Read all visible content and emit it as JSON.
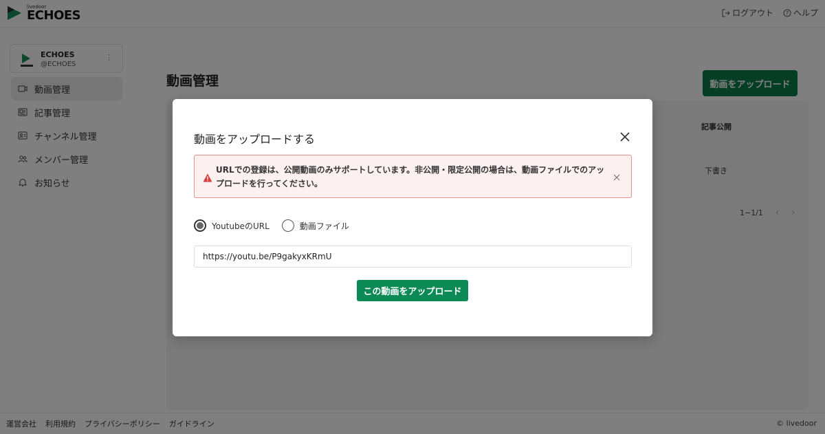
{
  "header": {
    "logo_small": "livedoor",
    "logo_big": "ECHOES",
    "logout_label": "ログアウト",
    "help_label": "ヘルプ"
  },
  "sidebar": {
    "channel": {
      "name": "ECHOES",
      "handle": "@ECHOES",
      "more_icon": "⋮"
    },
    "items": [
      {
        "label": "動画管理",
        "icon": "video-icon",
        "active": true
      },
      {
        "label": "記事管理",
        "icon": "article-icon",
        "active": false
      },
      {
        "label": "チャンネル管理",
        "icon": "channel-icon",
        "active": false
      },
      {
        "label": "メンバー管理",
        "icon": "members-icon",
        "active": false
      },
      {
        "label": "お知らせ",
        "icon": "bell-icon",
        "active": false
      }
    ]
  },
  "main": {
    "title": "動画管理",
    "upload_button": "動画をアップロード",
    "column_header": "記事公開",
    "draft_cell": "下書き",
    "pager_text": "1−1/1"
  },
  "footer": {
    "links": [
      "運営会社",
      "利用規約",
      "プライバシーポリシー",
      "ガイドライン"
    ],
    "copyright": "© livedoor"
  },
  "modal": {
    "title": "動画をアップロードする",
    "alert_text": "URLでの登録は、公開動画のみサポートしています。非公開・限定公開の場合は、動画ファイルでのアップロードを行ってください。",
    "radio_options": [
      {
        "label": "YoutubeのURL",
        "checked": true
      },
      {
        "label": "動画ファイル",
        "checked": false
      }
    ],
    "url_value": "https://youtu.be/P9gakyxKRmU",
    "submit_label": "この動画をアップロード"
  },
  "colors": {
    "brand_green": "#0b8a55",
    "alert_border": "#e58f8f",
    "alert_bg": "#fcf0f0",
    "alert_icon": "#d93a3a"
  }
}
